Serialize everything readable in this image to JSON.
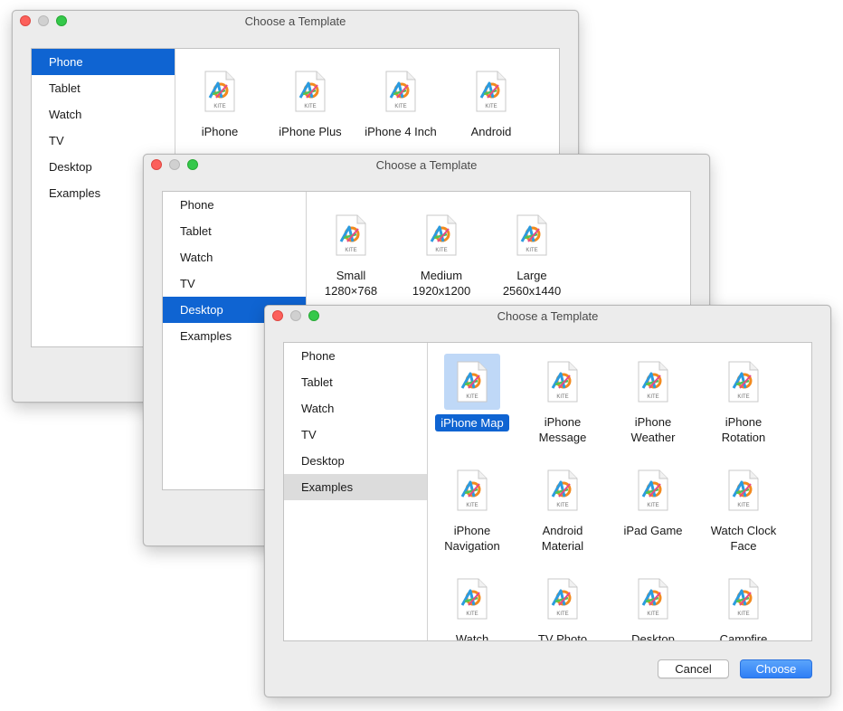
{
  "windows": [
    {
      "title": "Choose a Template",
      "sidebar": [
        "Phone",
        "Tablet",
        "Watch",
        "TV",
        "Desktop",
        "Examples"
      ],
      "selected": "Phone",
      "templates": [
        {
          "label": "iPhone"
        },
        {
          "label": "iPhone Plus"
        },
        {
          "label": "iPhone 4 Inch"
        },
        {
          "label": "Android"
        }
      ]
    },
    {
      "title": "Choose a Template",
      "sidebar": [
        "Phone",
        "Tablet",
        "Watch",
        "TV",
        "Desktop",
        "Examples"
      ],
      "selected": "Desktop",
      "templates": [
        {
          "label": "Small\n1280×768"
        },
        {
          "label": "Medium\n1920x1200"
        },
        {
          "label": "Large\n2560x1440"
        }
      ]
    },
    {
      "title": "Choose a Template",
      "sidebar": [
        "Phone",
        "Tablet",
        "Watch",
        "TV",
        "Desktop",
        "Examples"
      ],
      "selected": "Examples",
      "templates": [
        {
          "label": "iPhone Map",
          "selected": true
        },
        {
          "label": "iPhone\nMessage"
        },
        {
          "label": "iPhone\nWeather"
        },
        {
          "label": "iPhone\nRotation"
        },
        {
          "label": "iPhone\nNavigation"
        },
        {
          "label": "Android\nMaterial"
        },
        {
          "label": "iPad Game"
        },
        {
          "label": "Watch Clock\nFace"
        },
        {
          "label": "Watch"
        },
        {
          "label": "TV Photo"
        },
        {
          "label": "Desktop"
        },
        {
          "label": "Campfire"
        }
      ],
      "buttons": {
        "cancel": "Cancel",
        "choose": "Choose"
      }
    }
  ],
  "file_icon": {
    "name": "kite-file-icon",
    "badge": "KITE"
  },
  "colors": {
    "accent": "#0f64d2",
    "selected_tile_bg": "#bfd8f7",
    "close": "#fc605b",
    "max": "#34c84a"
  }
}
